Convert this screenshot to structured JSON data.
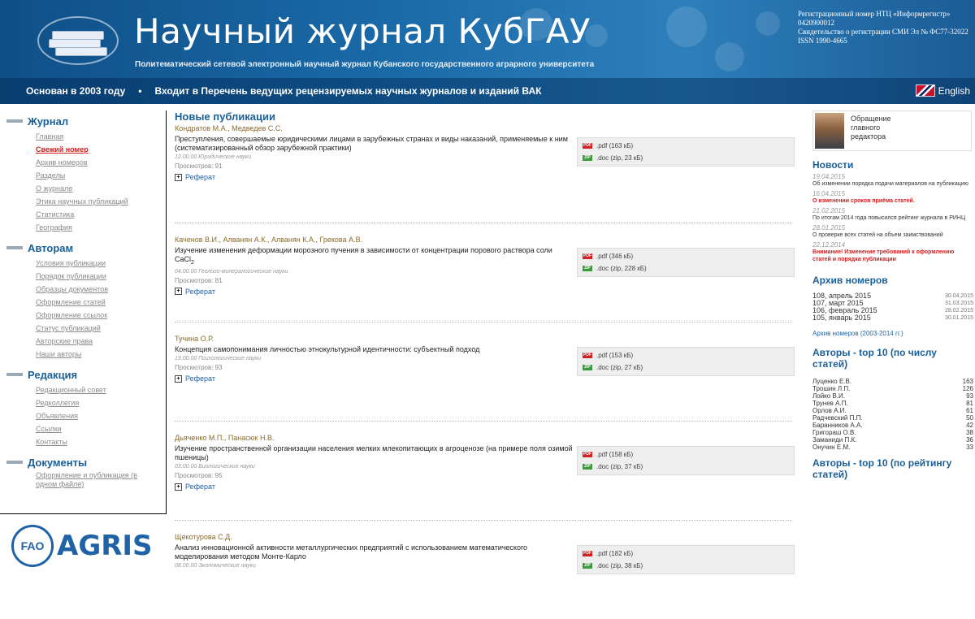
{
  "header": {
    "title": "Научный журнал КубГАУ",
    "subtitle": "Политематический сетевой электронный научный журнал Кубанского государственного аграрного университета",
    "registration": [
      "Регистрационный номер НТЦ «Информрегистр» 0420900012",
      "Свидетельство о регистрации СМИ Эл № ФС77-32022",
      "ISSN 1990-4665"
    ],
    "founded": "Основан в 2003 году",
    "vak": "Входит в Перечень ведущих рецензируемых научных журналов и изданий ВАК",
    "lang": "English"
  },
  "sidebar": {
    "sections": [
      {
        "title": "Журнал",
        "items": [
          "Главная",
          "Свежий номер",
          "Архив номеров",
          "Разделы",
          "О журнале",
          "Этика научных публикаций",
          "Статистика",
          "География"
        ]
      },
      {
        "title": "Авторам",
        "items": [
          "Условия публикации",
          "Порядок публикации",
          "Образцы документов",
          "Оформление статей",
          "Оформление ссылок",
          "Статус публикаций",
          "Авторские права",
          "Наши авторы"
        ]
      },
      {
        "title": "Редакция",
        "items": [
          "Редакционный совет",
          "Редколлегия",
          "Объявления",
          "Ссылки",
          "Контакты"
        ]
      },
      {
        "title": "Документы",
        "items": [
          "Оформление и публикация (в одном файле)"
        ]
      }
    ],
    "agris": {
      "fao": "FAO",
      "text": "AGRIS"
    }
  },
  "main": {
    "title": "Новые публикации",
    "views_label": "Просмотров:",
    "abstract_label": "Реферат",
    "publications": [
      {
        "authors": "Кондратов М.А., Медведев С.С.",
        "title": "Преступления, совершаемые юридическими лицами в зарубежных странах и виды наказаний, применяемые к ним (систематизированный обзор зарубежной практики)",
        "category": "12.00.00 Юридические науки",
        "views": "Просмотров: 91",
        "pdf": ".pdf (163 кБ)",
        "doc": ".doc (zip, 23 кБ)"
      },
      {
        "authors": "Каченов В.И., Алванян А.К., Алванян К.А., Грекова А.В.",
        "title": "Изучение изменения деформации морозного пучения в зависимости от концентрации порового раствора соли CaCl",
        "title_sub": "2",
        "category": "04.00.00 Геолого-минералогические науки",
        "views": "Просмотров: 81",
        "pdf": ".pdf (346 кБ)",
        "doc": ".doc (zip, 228 кБ)"
      },
      {
        "authors": "Тучина О.Р.",
        "title": "Концепция самопонимания личностью этнокультурной идентичности: субъектный подход",
        "category": "19.00.00 Психологические науки",
        "views": "Просмотров: 93",
        "pdf": ".pdf (153 кБ)",
        "doc": ".doc (zip, 27 кБ)"
      },
      {
        "authors": "Дьяченко М.П., Панасюк Н.В.",
        "title": "Изучение пространственной организации населения мелких млекопитающих в агроценозе (на примере поля озимой пшеницы)",
        "category": "03.00.00 Биологические науки",
        "views": "Просмотров: 95",
        "pdf": ".pdf (158 кБ)",
        "doc": ".doc (zip, 37 кБ)"
      },
      {
        "authors": "Щекотурова С.Д.",
        "title": "Анализ инновационной активности металлургических предприятий с использованием математического моделирования методом Монте-Карло",
        "category": "08.00.00 Экономические науки",
        "views": "",
        "pdf": ".pdf (182 кБ)",
        "doc": ".doc (zip, 38 кБ)"
      }
    ]
  },
  "right": {
    "editor": "Обращение главного редактора",
    "news_title": "Новости",
    "news": [
      {
        "date": "19.04.2015",
        "text": "Об изменении порядка подачи материалов на публикацию",
        "red": false
      },
      {
        "date": "16.04.2015",
        "text": "О изменении сроков приёма статей.",
        "red": true
      },
      {
        "date": "21.02.2015",
        "text": "По итогам 2014 года повысился рейтинг журнала в РИНЦ",
        "red": false
      },
      {
        "date": "28.01.2015",
        "text": "О проверке всех статей на объем заимствований",
        "red": false
      },
      {
        "date": "22.12.2014",
        "text": "Внимание! Изменение требований к оформлению статей и порядка публикации",
        "red": true
      }
    ],
    "archive_title": "Архив номеров",
    "archive": [
      {
        "issue": "108,  апрель 2015",
        "date": "30.04.2015"
      },
      {
        "issue": "107,  март 2015",
        "date": "31.03.2015"
      },
      {
        "issue": "106,  февраль 2015",
        "date": "28.02.2015"
      },
      {
        "issue": "105,  январь 2015",
        "date": "30.01.2015"
      }
    ],
    "archive_link": "Архив номеров (2003-2014 гг.)",
    "top_articles_title": "Авторы - top 10 (по числу статей)",
    "top_authors": [
      {
        "name": "Луценко Е.В.",
        "count": "163"
      },
      {
        "name": "Трошин Л.П.",
        "count": "126"
      },
      {
        "name": "Лойко В.И.",
        "count": "93"
      },
      {
        "name": "Трунев А.П.",
        "count": "81"
      },
      {
        "name": "Орлов А.И.",
        "count": "61"
      },
      {
        "name": "Радчевский П.П.",
        "count": "50"
      },
      {
        "name": "Баранников А.А.",
        "count": "42"
      },
      {
        "name": "Григораш О.В.",
        "count": "38"
      },
      {
        "name": "Заманиди П.К.",
        "count": "36"
      },
      {
        "name": "Онучин Е.М.",
        "count": "33"
      }
    ],
    "top_rating_title": "Авторы - top 10 (по рейтингу статей)"
  }
}
